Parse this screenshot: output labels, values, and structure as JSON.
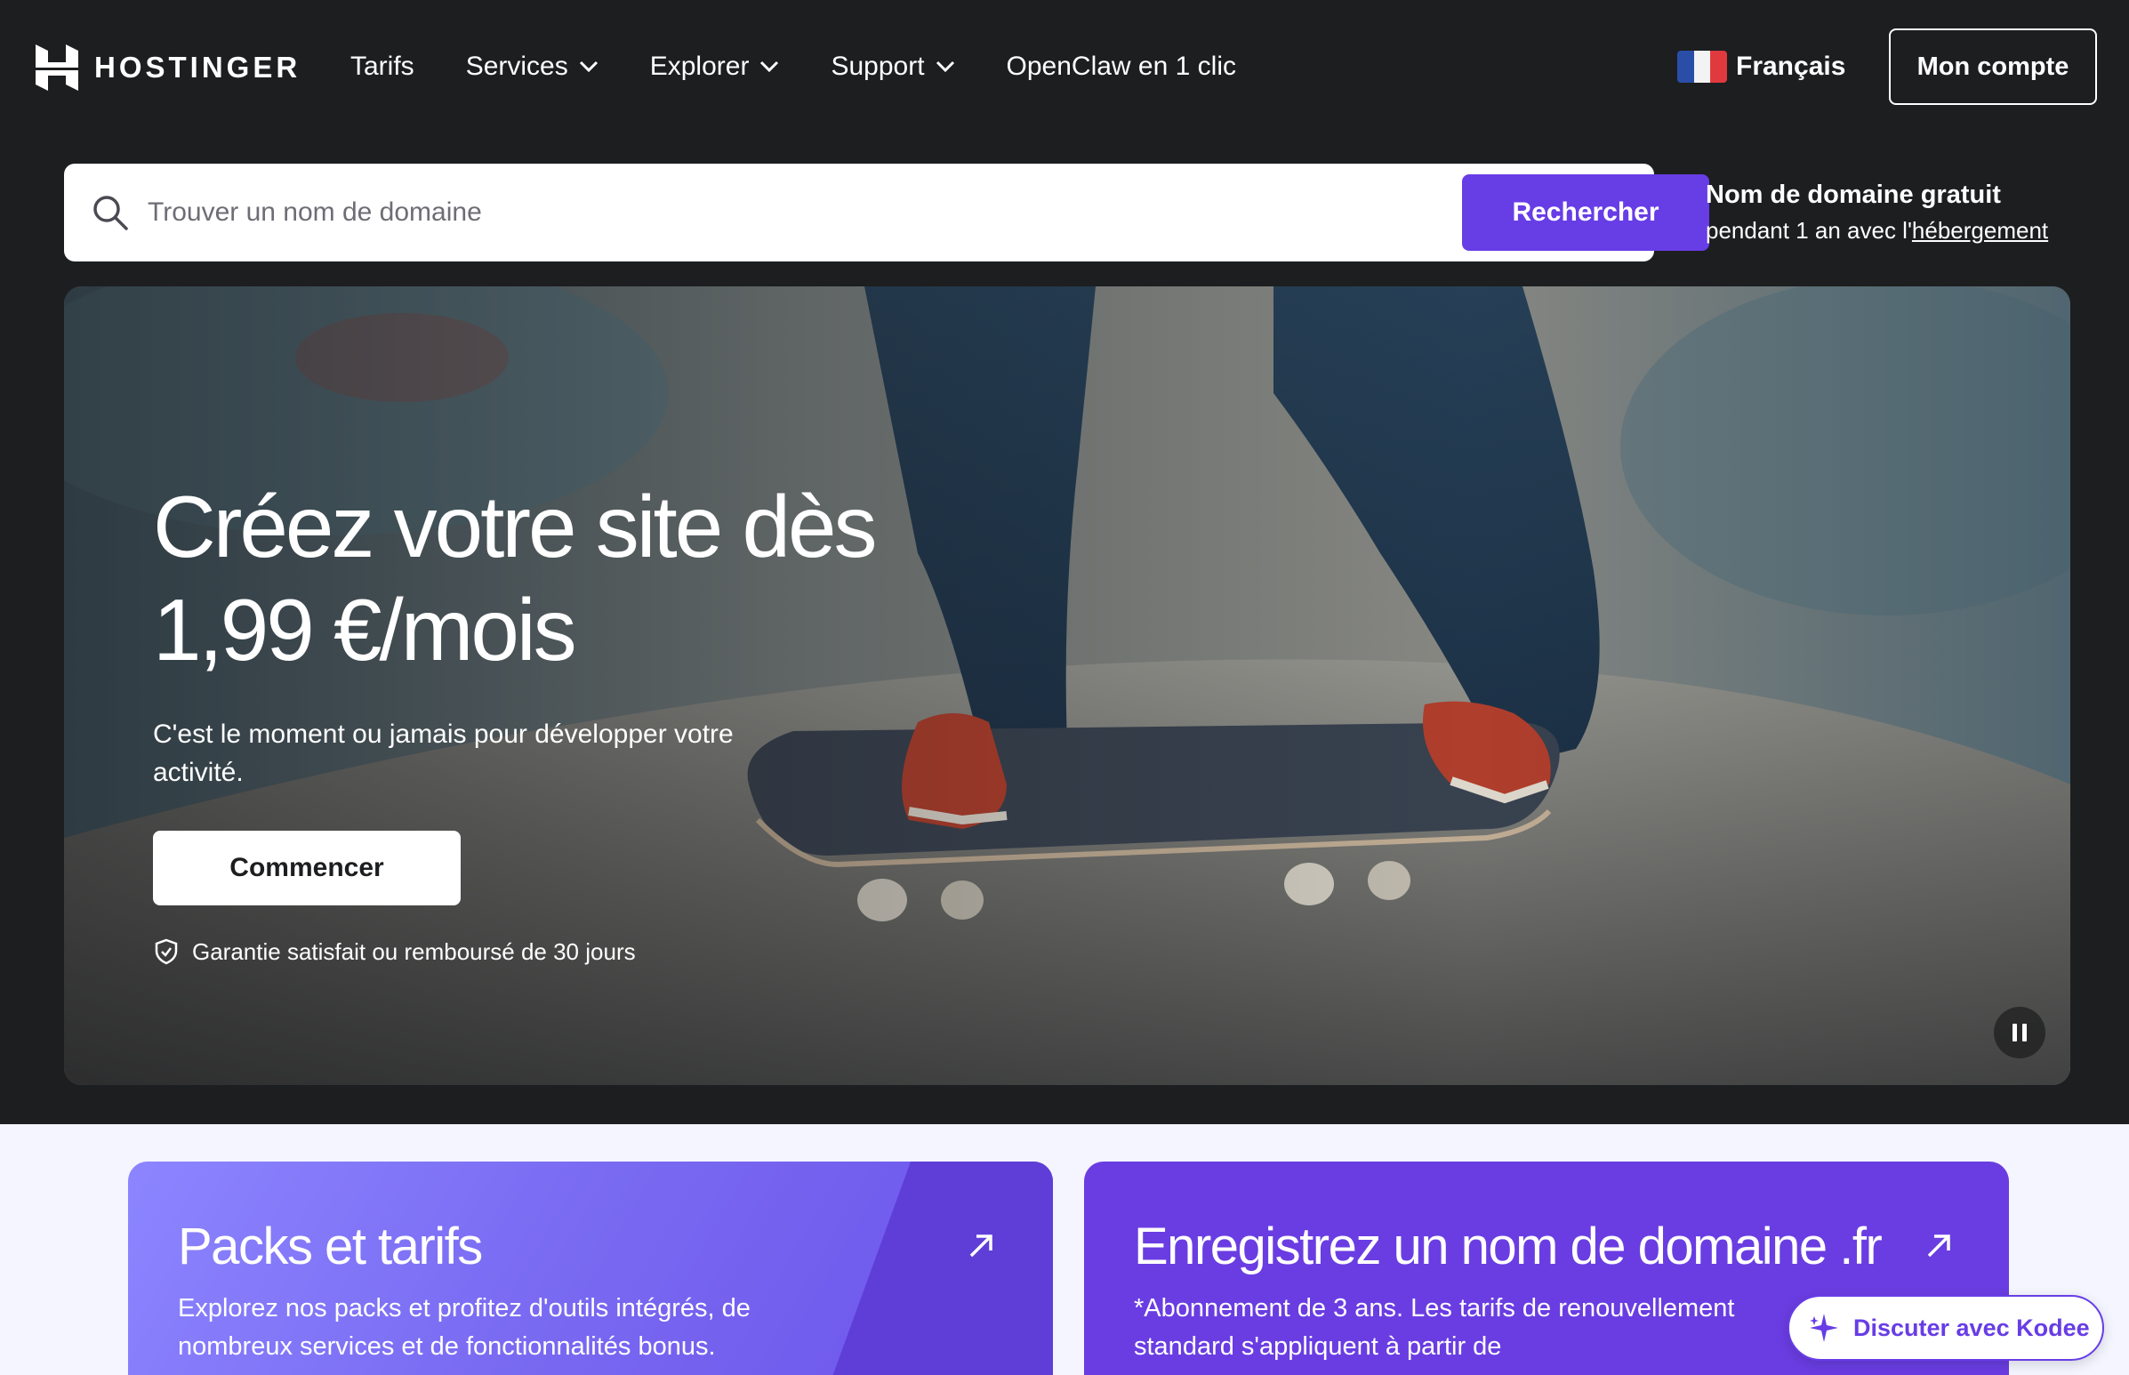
{
  "brand": {
    "name": "HOSTINGER"
  },
  "nav": {
    "items": [
      {
        "label": "Tarifs",
        "has_dropdown": false
      },
      {
        "label": "Services",
        "has_dropdown": true
      },
      {
        "label": "Explorer",
        "has_dropdown": true
      },
      {
        "label": "Support",
        "has_dropdown": true
      },
      {
        "label": "OpenClaw en 1 clic",
        "has_dropdown": false
      }
    ],
    "language": "Français",
    "account_label": "Mon compte"
  },
  "search": {
    "placeholder": "Trouver un nom de domaine",
    "value": "",
    "button_label": "Rechercher"
  },
  "promo": {
    "title": "Nom de domaine gratuit",
    "subtitle_prefix": "pendant 1 an avec l'",
    "subtitle_link": "hébergement"
  },
  "hero": {
    "title_line1": "Créez votre site dès",
    "title_line2": "1,99 €/mois",
    "description": "C'est le moment ou jamais pour développer votre activité.",
    "cta_label": "Commencer",
    "guarantee": "Garantie satisfait ou remboursé de 30 jours"
  },
  "cards": [
    {
      "title": "Packs et tarifs",
      "description": "Explorez nos packs et profitez d'outils intégrés, de nombreux services et de fonctionnalités bonus."
    },
    {
      "title": "Enregistrez un nom de domaine .fr",
      "description": "*Abonnement de 3 ans. Les tarifs de renouvellement standard s'appliquent à partir de"
    }
  ],
  "chat": {
    "label": "Discuter avec Kodee"
  },
  "colors": {
    "background_dark": "#1d1e20",
    "accent": "#673de6",
    "lower_background": "#f4f5ff"
  },
  "icons": [
    "hostinger-logo-icon",
    "chevron-down-icon",
    "france-flag-icon",
    "search-icon",
    "shield-check-icon",
    "pause-icon",
    "arrow-up-right-icon",
    "kodee-sparkle-icon"
  ]
}
